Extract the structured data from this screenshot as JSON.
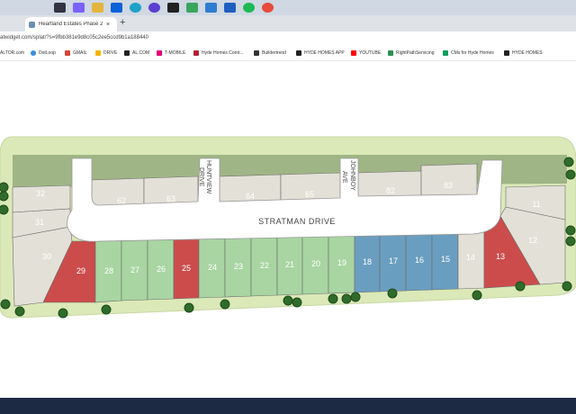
{
  "browser": {
    "tab_title": "Heartland Estates Phase 2 on ",
    "new_tab_glyph": "+",
    "url": "atwidget.com/splat/?s=9fbb381e9d8c05c2ee5ccd9b1a188440",
    "bookmarks": [
      "ALTOR.com",
      "DotLoop",
      "GMAIL",
      "DRIVE",
      "AL.COM",
      "T-MOBILE",
      "Hyde Homes Contr...",
      "Buildertrend",
      "HYDE HOMES APP",
      "YOUTUBE",
      "RightPathServicing",
      "CMs for Hyde Homes",
      "HYDE HOMES"
    ]
  },
  "map": {
    "streets": {
      "main": "STRATMAN DRIVE",
      "huntview": [
        "HUNTVIEW",
        "DRIVE"
      ],
      "johnboy": [
        "JOHNBOY",
        "AVE"
      ]
    },
    "colors": {
      "available": "#a8d5a2",
      "sold": "#cc4c4c",
      "pending": "#6a9ec0",
      "unreleased": "#e3e0d7",
      "park": "#dbe9b8",
      "berm": "#a0b585",
      "road": "#ffffff",
      "outline": "#6b6b6b",
      "tree": "#2f6b2a"
    },
    "lots": [
      {
        "id": "32",
        "status": "unreleased"
      },
      {
        "id": "31",
        "status": "unreleased"
      },
      {
        "id": "30",
        "status": "unreleased"
      },
      {
        "id": "29",
        "status": "sold"
      },
      {
        "id": "28",
        "status": "available"
      },
      {
        "id": "27",
        "status": "available"
      },
      {
        "id": "26",
        "status": "available"
      },
      {
        "id": "25",
        "status": "sold"
      },
      {
        "id": "24",
        "status": "available"
      },
      {
        "id": "23",
        "status": "available"
      },
      {
        "id": "22",
        "status": "available"
      },
      {
        "id": "21",
        "status": "available"
      },
      {
        "id": "20",
        "status": "available"
      },
      {
        "id": "19",
        "status": "available"
      },
      {
        "id": "18",
        "status": "pending"
      },
      {
        "id": "17",
        "status": "pending"
      },
      {
        "id": "16",
        "status": "pending"
      },
      {
        "id": "15",
        "status": "pending"
      },
      {
        "id": "14",
        "status": "unreleased"
      },
      {
        "id": "13",
        "status": "sold"
      },
      {
        "id": "12",
        "status": "unreleased"
      },
      {
        "id": "11",
        "status": "unreleased"
      },
      {
        "id": "62",
        "status": "unreleased"
      },
      {
        "id": "63",
        "status": "unreleased"
      },
      {
        "id": "64",
        "status": "unreleased"
      },
      {
        "id": "65",
        "status": "unreleased"
      },
      {
        "id": "82",
        "status": "unreleased"
      },
      {
        "id": "83",
        "status": "unreleased"
      }
    ]
  }
}
